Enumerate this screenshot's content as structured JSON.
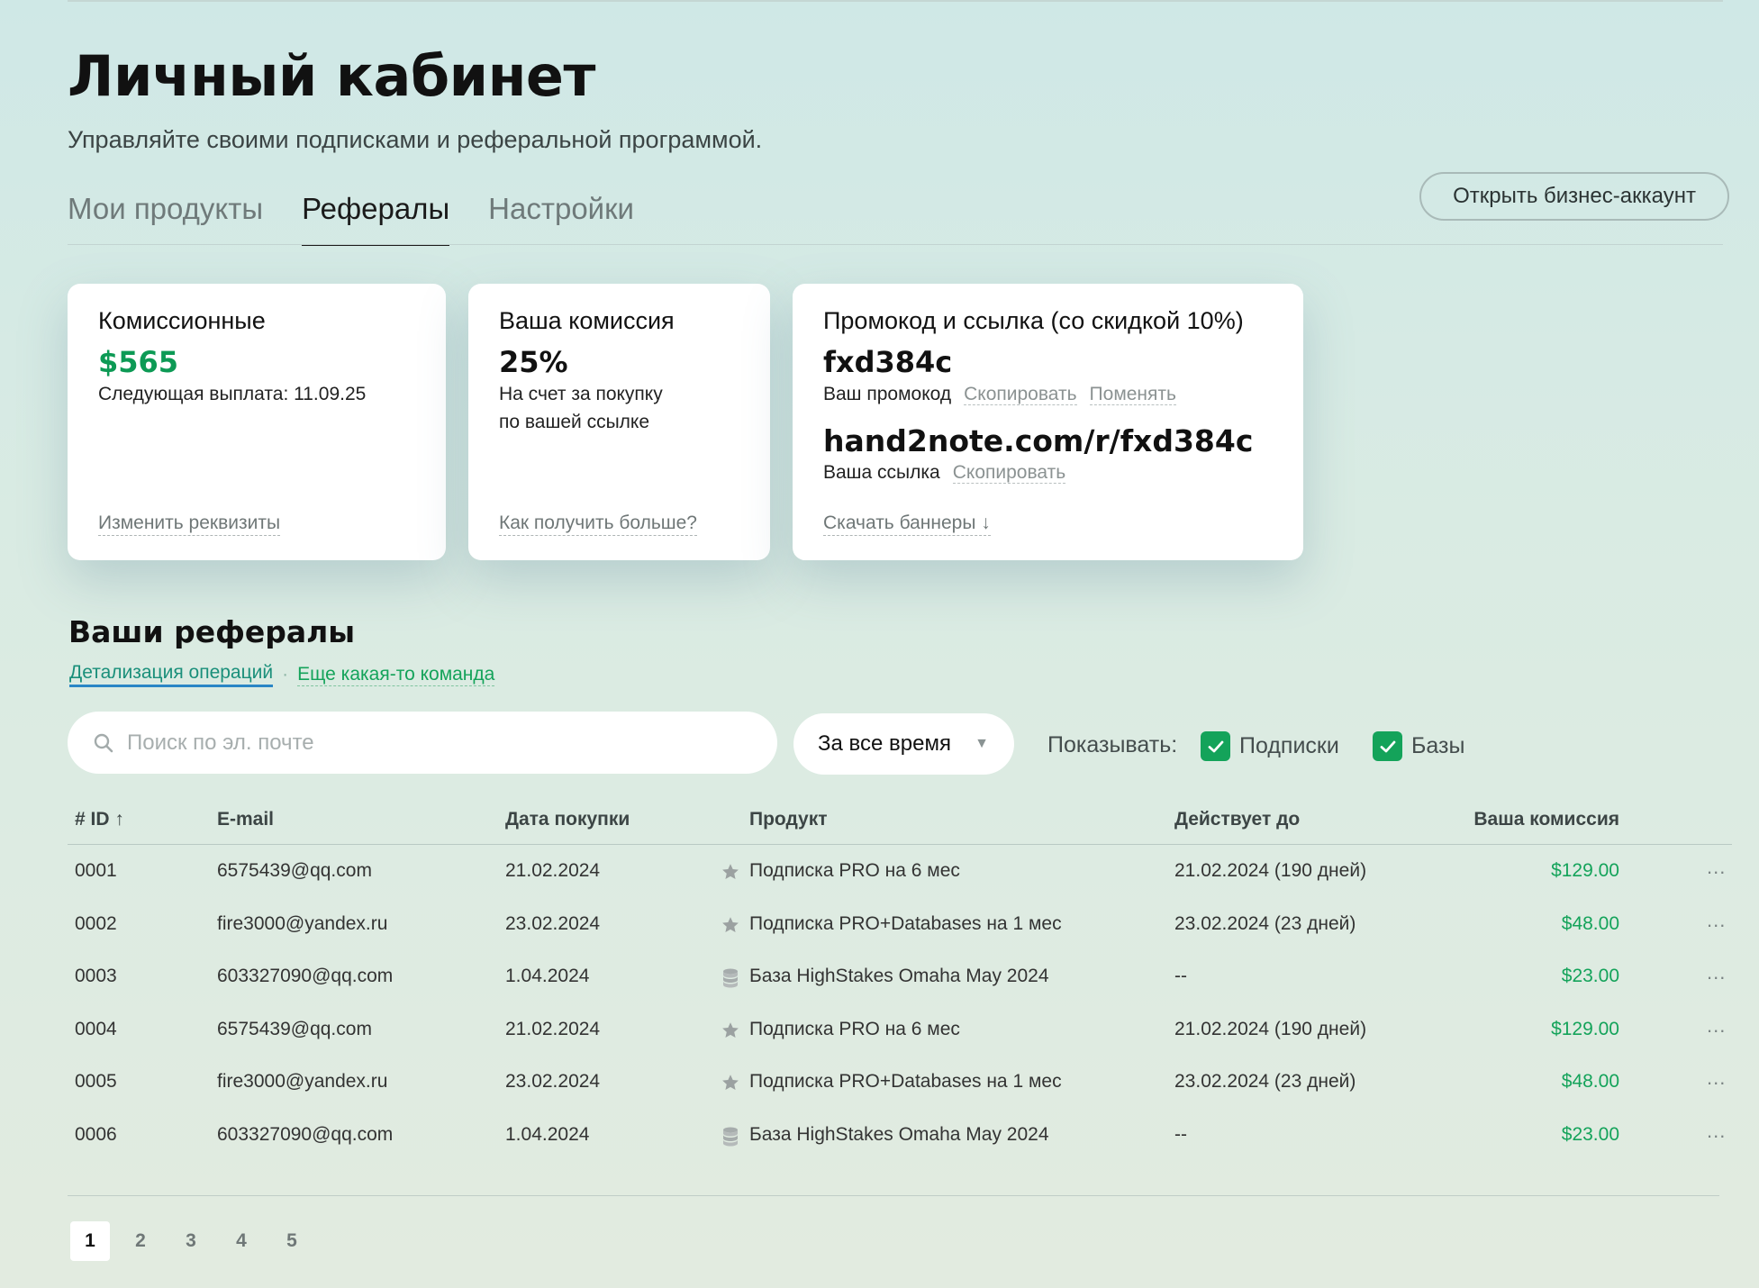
{
  "header": {
    "title": "Личный кабинет",
    "subtitle": "Управляйте своими подписками и реферальной программой."
  },
  "tabs": [
    {
      "label": "Мои продукты",
      "active": false
    },
    {
      "label": "Рефералы",
      "active": true
    },
    {
      "label": "Настройки",
      "active": false
    }
  ],
  "business_button": "Открыть бизнес-аккаунт",
  "cards": {
    "commission": {
      "title": "Комиссионные",
      "amount": "$565",
      "next_payout": "Следующая выплата: 11.09.25",
      "link": "Изменить реквизиты"
    },
    "rate": {
      "title": "Ваша комиссия",
      "value": "25%",
      "desc_line1": "На счет за покупку",
      "desc_line2": "по вашей ссылке",
      "link": "Как получить больше?"
    },
    "promo": {
      "title": "Промокод и ссылка (со скидкой 10%)",
      "code": "fxd384c",
      "code_label": "Ваш промокод",
      "copy": "Скопировать",
      "change": "Поменять",
      "url": "hand2note.com/r/fxd384c",
      "url_label": "Ваша ссылка",
      "download": "Скачать баннеры ↓"
    }
  },
  "referrals": {
    "title": "Ваши рефералы",
    "links": [
      "Детализация операций",
      "Еще какая-то команда"
    ],
    "search_placeholder": "Поиск по эл. почте",
    "period": "За все время",
    "show_label": "Показывать:",
    "filters": [
      "Подписки",
      "Базы"
    ]
  },
  "table": {
    "columns": [
      "# ID ↑",
      "E-mail",
      "Дата покупки",
      "Продукт",
      "Действует до",
      "Ваша комиссия"
    ],
    "rows": [
      {
        "id": "0001",
        "email": "6575439@qq.com",
        "date": "21.02.2024",
        "icon": "star",
        "product": "Подписка PRO на 6 мес",
        "valid": "21.02.2024 (190 дней)",
        "commission": "$129.00"
      },
      {
        "id": "0002",
        "email": "fire3000@yandex.ru",
        "date": "23.02.2024",
        "icon": "star",
        "product": "Подписка PRO+Databases на 1 мес",
        "valid": "23.02.2024 (23 дней)",
        "commission": "$48.00"
      },
      {
        "id": "0003",
        "email": "603327090@qq.com",
        "date": "1.04.2024",
        "icon": "database",
        "product": "База HighStakes Omaha May 2024",
        "valid": "--",
        "commission": "$23.00"
      },
      {
        "id": "0004",
        "email": "6575439@qq.com",
        "date": "21.02.2024",
        "icon": "star",
        "product": "Подписка PRO на 6 мес",
        "valid": "21.02.2024 (190 дней)",
        "commission": "$129.00"
      },
      {
        "id": "0005",
        "email": "fire3000@yandex.ru",
        "date": "23.02.2024",
        "icon": "star",
        "product": "Подписка PRO+Databases на 1 мес",
        "valid": "23.02.2024 (23 дней)",
        "commission": "$48.00"
      },
      {
        "id": "0006",
        "email": "603327090@qq.com",
        "date": "1.04.2024",
        "icon": "database",
        "product": "База HighStakes Omaha May 2024",
        "valid": "--",
        "commission": "$23.00"
      }
    ],
    "more": "..."
  },
  "pagination": {
    "pages": [
      "1",
      "2",
      "3",
      "4",
      "5"
    ],
    "current": "1"
  },
  "colors": {
    "accent_green": "#14a35a",
    "link_blue": "#2a86c6"
  }
}
